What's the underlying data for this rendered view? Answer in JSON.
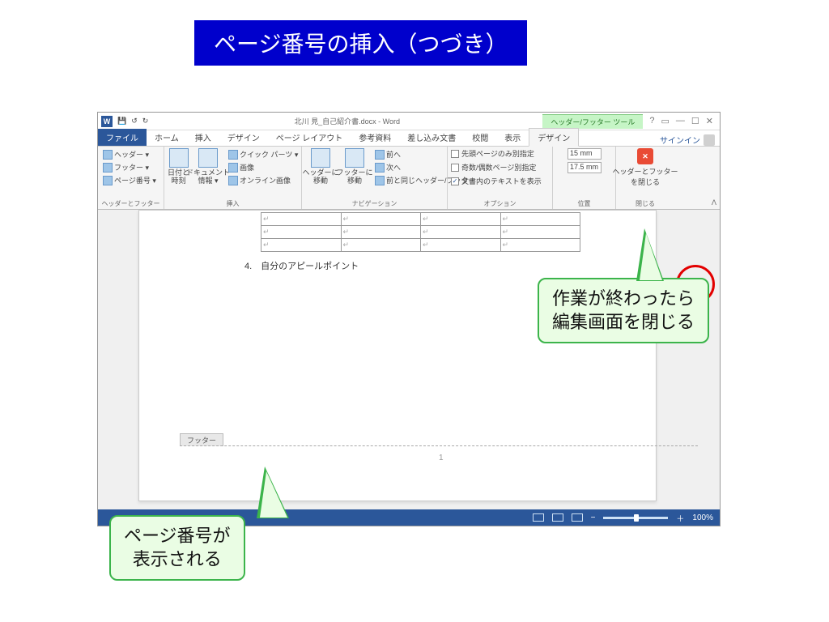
{
  "slide": {
    "title": "ページ番号の挿入（つづき）"
  },
  "titlebar": {
    "save_icon": "💾",
    "undo_icon": "↺",
    "redo_icon": "↻",
    "doc_title": "北川 見_自己紹介書.docx - Word",
    "context_tab": "ヘッダー/フッター ツール",
    "help": "?",
    "full": "▭",
    "min": "—",
    "rest": "☐",
    "close": "✕"
  },
  "tabs": {
    "file": "ファイル",
    "t": [
      "ホーム",
      "挿入",
      "デザイン",
      "ページ レイアウト",
      "参考資料",
      "差し込み文書",
      "校閲",
      "表示",
      "デザイン"
    ],
    "signin": "サインイン"
  },
  "ribbon": {
    "g0": {
      "label": "ヘッダーとフッター",
      "items": [
        "ヘッダー ▾",
        "フッター ▾",
        "ページ番号 ▾"
      ]
    },
    "g1": {
      "label": "挿入",
      "date": "日付と\n時刻",
      "docinfo": "ドキュメント\n情報 ▾",
      "quick": "クイック パーツ ▾",
      "pic": "画像",
      "online": "オンライン画像"
    },
    "g2": {
      "label": "ナビゲーション",
      "gohdr": "ヘッダーに\n移動",
      "goftr": "フッターに\n移動",
      "prev": "前へ",
      "next": "次へ",
      "link": "前と同じヘッダー/フッター"
    },
    "g3": {
      "label": "オプション",
      "c1": "先頭ページのみ別指定",
      "c2": "奇数/偶数ページ別指定",
      "c3": "文書内のテキストを表示"
    },
    "g4": {
      "label": "位置",
      "top": "15 mm",
      "bot": "17.5 mm"
    },
    "g5": {
      "label": "閉じる",
      "btn": "ヘッダーとフッター\nを閉じる"
    }
  },
  "document": {
    "heading": "4.　自分のアピールポイント",
    "footer_label": "フッター",
    "page_number": "1"
  },
  "status": {
    "zoom": "100%",
    "minus": "−",
    "plus": "＋"
  },
  "callouts": {
    "c1a": "作業が終わったら",
    "c1b": "編集画面を閉じる",
    "c2a": "ページ番号が",
    "c2b": "表示される"
  }
}
